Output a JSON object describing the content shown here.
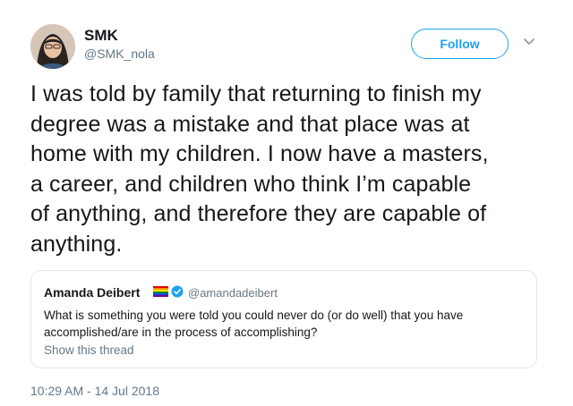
{
  "author": {
    "name": "SMK",
    "handle": "@SMK_nola"
  },
  "follow_button": {
    "label": "Follow"
  },
  "tweet": {
    "text": "I was told by family that returning to finish my\ndegree was a mistake and that place was at\nhome with my children. I now have a masters,\na career, and children who think I’m capable\nof anything, and therefore they are capable of\nanything.",
    "timestamp": "10:29 AM - 14 Jul 2018"
  },
  "quoted_tweet": {
    "name": "Amanda Deibert",
    "handle": "@amandadeibert",
    "text": "What is something you were told you could never do (or do well) that you have accomplished/are in the process of accomplishing?",
    "show_thread": "Show this thread"
  },
  "colors": {
    "accent": "#1da1f2",
    "secondary_text": "#657786",
    "border": "#e1e8ed"
  },
  "icons": [
    "avatar",
    "chevron-down-icon",
    "rainbow-flag-icon",
    "verified-badge-icon"
  ]
}
